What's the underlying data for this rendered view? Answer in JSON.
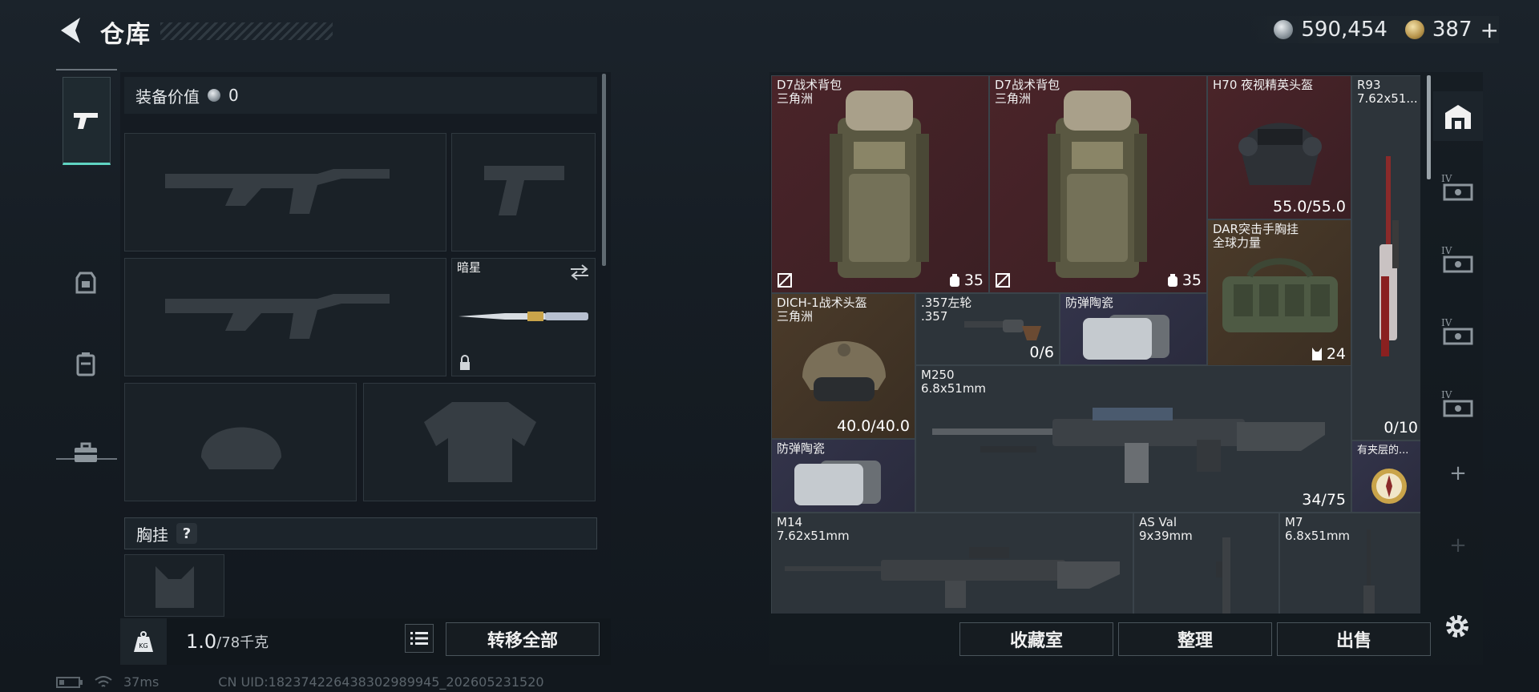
{
  "header": {
    "title": "仓库",
    "currency_silver": "590,454",
    "currency_gold": "387",
    "add": "+"
  },
  "left": {
    "equip_value_label": "装备价值",
    "equip_value": "0",
    "melee_name": "暗星",
    "chest_label": "胸挂",
    "help": "?",
    "weight_value": "1.0",
    "weight_unit": "/78千克",
    "kg_icon_text": "KG",
    "transfer_all": "转移全部"
  },
  "items": [
    {
      "name": "D7战术背包",
      "sub": "三角洲",
      "badge": "35"
    },
    {
      "name": "D7战术背包",
      "sub": "三角洲",
      "badge": "35"
    },
    {
      "name": "H70 夜视精英头盔",
      "value": "55.0/55.0"
    },
    {
      "name": "R93",
      "sub": "7.62x51...",
      "value": "0/10"
    },
    {
      "name": "DAR突击手胸挂",
      "sub": "全球力量",
      "badge": "24"
    },
    {
      "name": "DICH-1战术头盔",
      "sub": "三角洲",
      "value": "40.0/40.0"
    },
    {
      "name": ".357左轮",
      "sub": ".357",
      "value": "0/6"
    },
    {
      "name": "防弹陶瓷"
    },
    {
      "name": "M250",
      "sub": "6.8x51mm",
      "value": "34/75"
    },
    {
      "name": "防弹陶瓷"
    },
    {
      "name": "有夹层的..."
    },
    {
      "name": "M14",
      "sub": "7.62x51mm"
    },
    {
      "name": "AS Val",
      "sub": "9x39mm"
    },
    {
      "name": "M7",
      "sub": "6.8x51mm"
    }
  ],
  "right_sidebar": {
    "tier_label": "IV",
    "add": "+"
  },
  "actions": {
    "collection": "收藏室",
    "sort": "整理",
    "sell": "出售"
  },
  "status": {
    "ping": "37ms",
    "uid": "CN UID:1823742264383029899​45_202605231520"
  }
}
